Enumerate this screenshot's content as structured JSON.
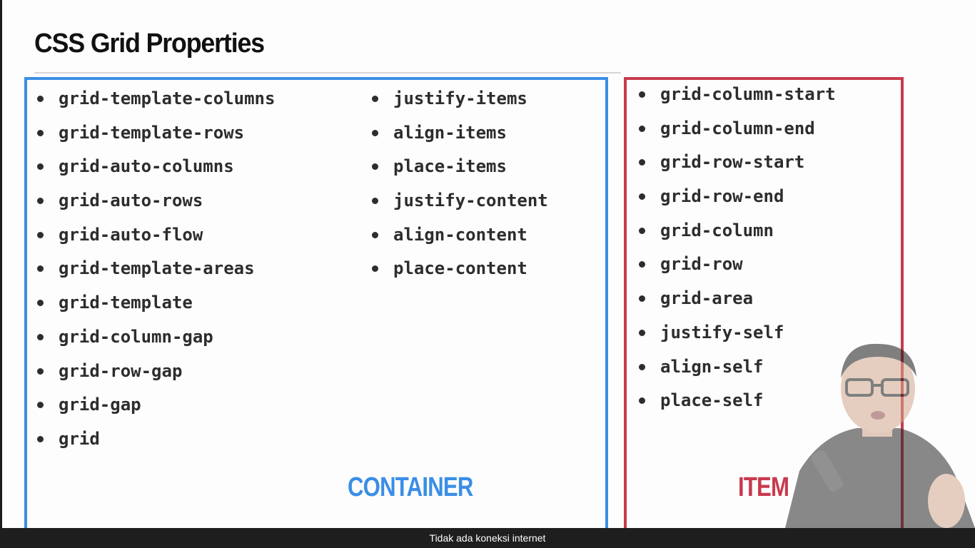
{
  "slide": {
    "title": "CSS Grid Properties",
    "container": {
      "label": "CONTAINER",
      "color": "#3a8ee6",
      "column1": [
        "grid-template-columns",
        "grid-template-rows",
        "grid-auto-columns",
        "grid-auto-rows",
        "grid-auto-flow",
        "grid-template-areas",
        "grid-template",
        "grid-column-gap",
        "grid-row-gap",
        "grid-gap",
        "grid"
      ],
      "column2": [
        "justify-items",
        "align-items",
        "place-items",
        "justify-content",
        "align-content",
        "place-content"
      ]
    },
    "item": {
      "label": "ITEM",
      "color": "#c83a4e",
      "list": [
        "grid-column-start",
        "grid-column-end",
        "grid-row-start",
        "grid-row-end",
        "grid-column",
        "grid-row",
        "grid-area",
        "justify-self",
        "align-self",
        "place-self"
      ]
    }
  },
  "status_bar": {
    "message": "Tidak ada koneksi internet"
  }
}
